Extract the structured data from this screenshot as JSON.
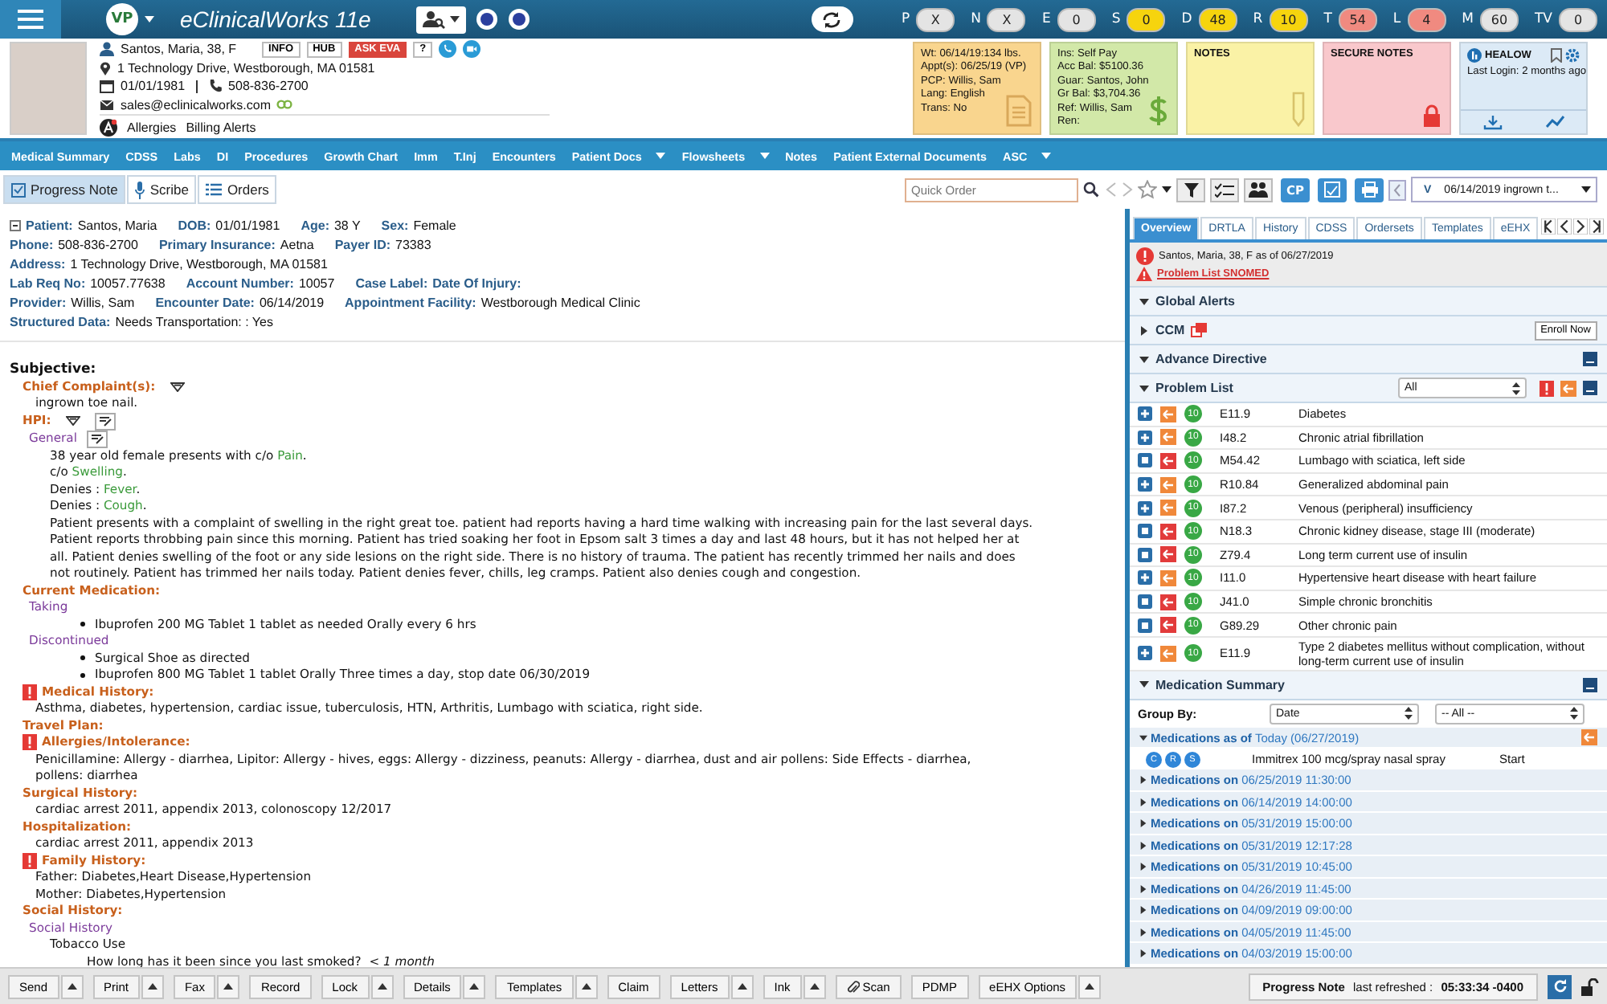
{
  "top_bar": {
    "avatar": "VP",
    "title": "eClinicalWorks 11e",
    "counters": [
      {
        "letter": "P",
        "value": "X",
        "color": "#e4e4e4"
      },
      {
        "letter": "N",
        "value": "X",
        "color": "#e4e4e4"
      },
      {
        "letter": "E",
        "value": "0",
        "color": "#e4e4e4"
      },
      {
        "letter": "S",
        "value": "0",
        "color": "#f6d40e"
      },
      {
        "letter": "D",
        "value": "48",
        "color": "#f6d40e"
      },
      {
        "letter": "R",
        "value": "10",
        "color": "#f6d40e"
      },
      {
        "letter": "T",
        "value": "54",
        "color": "#f08a80"
      },
      {
        "letter": "L",
        "value": "4",
        "color": "#f08a80"
      },
      {
        "letter": "M",
        "value": "60",
        "color": "#e4e4e4"
      },
      {
        "letter": "TV",
        "value": "0",
        "color": "#e4e4e4"
      }
    ]
  },
  "patient": {
    "name": "Santos, Maria, 38, F",
    "buttons": [
      {
        "label": "INFO",
        "kind": "plain"
      },
      {
        "label": "HUB",
        "kind": "plain"
      },
      {
        "label": "ASK EVA",
        "kind": "accent"
      },
      {
        "label": "?",
        "kind": "plain"
      }
    ],
    "address": "1 Technology Drive, Westborough, MA 01581",
    "dob": "01/01/1981",
    "phone": "508-836-2700",
    "email": "sales@eclinicalworks.com",
    "links": [
      "Allergies",
      "Billing Alerts"
    ]
  },
  "cards": [
    {
      "kind": "vitals",
      "color": "#f9d58e",
      "lines": [
        "Wt: 06/14/19:134 lbs.",
        "Appt(s): 06/25/19 (VP)",
        "PCP: Willis, Sam",
        "Lang: English",
        "Trans: No"
      ]
    },
    {
      "kind": "billing",
      "color": "#d2e8a8",
      "lines": [
        "Ins: Self Pay",
        "Acc Bal: $5100.36",
        "Guar: Santos, John",
        "Gr Bal: $3,704.36",
        "Ref: Willis, Sam",
        "Ren:"
      ]
    },
    {
      "kind": "notes",
      "color": "#faf2a6",
      "title": "NOTES"
    },
    {
      "kind": "secure",
      "color": "#f9c8cc",
      "title": "SECURE NOTES"
    },
    {
      "kind": "healow",
      "color": "#dceaf6",
      "title": "HEALOW",
      "lines": [
        "Last Login: 2 months ago"
      ]
    }
  ],
  "nav": [
    {
      "label": "Medical Summary",
      "dropdown": false
    },
    {
      "label": "CDSS",
      "dropdown": false
    },
    {
      "label": "Labs",
      "dropdown": false
    },
    {
      "label": "DI",
      "dropdown": false
    },
    {
      "label": "Procedures",
      "dropdown": false
    },
    {
      "label": "Growth Chart",
      "dropdown": false
    },
    {
      "label": "Imm",
      "dropdown": false
    },
    {
      "label": "T.Inj",
      "dropdown": false
    },
    {
      "label": "Encounters",
      "dropdown": false
    },
    {
      "label": "Patient Docs",
      "dropdown": true
    },
    {
      "label": "Flowsheets",
      "dropdown": true
    },
    {
      "label": "Notes",
      "dropdown": false
    },
    {
      "label": "Patient External Documents",
      "dropdown": false
    },
    {
      "label": "ASC",
      "dropdown": true
    }
  ],
  "toolbar": {
    "tabs": [
      {
        "label": "Progress Note",
        "selected": true
      },
      {
        "label": "Scribe",
        "selected": false
      },
      {
        "label": "Orders",
        "selected": false
      }
    ],
    "quick_order": {
      "placeholder": "Quick Order"
    },
    "cp": "CP",
    "encounter": {
      "prefix": "V",
      "value": "06/14/2019 ingrown t..."
    }
  },
  "header_fields": [
    [
      {
        "label": "Patient:",
        "value": "Santos, Maria"
      },
      {
        "label": "DOB:",
        "value": "01/01/1981"
      },
      {
        "label": "Age:",
        "value": "38 Y"
      },
      {
        "label": "Sex:",
        "value": "Female"
      }
    ],
    [
      {
        "label": "Phone:",
        "value": "508-836-2700"
      },
      {
        "label": "Primary Insurance:",
        "value": "Aetna"
      },
      {
        "label": "Payer ID:",
        "value": "73383"
      }
    ],
    [
      {
        "label": "Address:",
        "value": "1 Technology Drive, Westborough, MA 01581"
      }
    ],
    [
      {
        "label": "Lab Req No:",
        "value": "10057.77638"
      },
      {
        "label": "Account Number:",
        "value": "10057"
      },
      {
        "label": "Case Label:"
      },
      {
        "label": "Date Of Injury:"
      }
    ],
    [
      {
        "label": "Provider:",
        "value": "Willis, Sam"
      },
      {
        "label": "Encounter Date:",
        "value": "06/14/2019"
      },
      {
        "label": "Appointment Facility:",
        "value": "Westborough Medical Clinic"
      }
    ],
    [
      {
        "label": "Structured Data:",
        "value": "Needs Transportation: : Yes"
      }
    ]
  ],
  "note": {
    "heading": "Subjective:",
    "sections": [
      {
        "title": "Chief Complaint(s):",
        "alert": false,
        "menu": true,
        "edit": false,
        "lines": [
          "ingrown toe nail."
        ]
      },
      {
        "title": "HPI:",
        "alert": false,
        "menu": true,
        "edit": true,
        "groups": [
          {
            "title": "General",
            "edit": true,
            "items": [
              {
                "kind": "finding",
                "prefix": "38 year old female presents with c/o ",
                "value": "Pain",
                "suffix": "."
              },
              {
                "kind": "finding",
                "prefix": "c/o ",
                "value": "Swelling",
                "suffix": "."
              },
              {
                "kind": "finding",
                "prefix": "Denies : ",
                "value": "Fever",
                "suffix": "."
              },
              {
                "kind": "finding",
                "prefix": "Denies : ",
                "value": "Cough",
                "suffix": "."
              },
              {
                "kind": "paragraph",
                "text": "Patient presents with a complaint of swelling in the right great toe. patient had reports having a hard time walking with increasing pain for the last several days. Patient reports throbbing pain since this morning. Patient has tried soaking her foot in Epsom salt 3 times a day and last 48 hours, but it has not helped her at all. Patient denies swelling of the foot or any side lesions on the right side. There is no history of trauma. The patient has recently trimmed her nails and does not routinely. Patient has trimmed her nails today. Patient denies fever, chills, leg cramps. Patient also denies cough and congestion."
              }
            ]
          }
        ]
      },
      {
        "title": "Current Medication:",
        "alert": false,
        "groups": [
          {
            "title": "Taking",
            "items": [
              {
                "kind": "bullet",
                "text": "Ibuprofen 200 MG Tablet 1 tablet as needed Orally every 6 hrs"
              }
            ]
          },
          {
            "title": "Discontinued",
            "items": [
              {
                "kind": "bullet",
                "text": "Surgical Shoe as directed"
              },
              {
                "kind": "bullet",
                "text": "Ibuprofen 800 MG Tablet 1 tablet Orally Three times a day, stop date 06/30/2019"
              }
            ]
          }
        ]
      },
      {
        "title": "Medical History:",
        "alert": true,
        "lines": [
          "Asthma, diabetes, hypertension, cardiac issue, tuberculosis, HTN, Arthritis, Lumbago with sciatica, right side."
        ]
      },
      {
        "title": "Travel Plan:",
        "alert": false
      },
      {
        "title": "Allergies/Intolerance:",
        "alert": true,
        "lines": [
          "Penicillamine: Allergy - diarrhea, Lipitor: Allergy - hives, eggs: Allergy - dizziness, peanuts: Allergy - diarrhea, dust and air pollens: Side Effects - diarrhea, pollens: diarrhea"
        ]
      },
      {
        "title": "Surgical History:",
        "alert": false,
        "lines": [
          "cardiac arrest 2011, appendix 2013, colonoscopy 12/2017"
        ]
      },
      {
        "title": "Hospitalization:",
        "alert": false,
        "lines": [
          "cardiac arrest 2011, appendix 2013"
        ]
      },
      {
        "title": "Family History:",
        "alert": true,
        "lines": [
          "Father: Diabetes,Heart Disease,Hypertension",
          "Mother: Diabetes,Hypertension"
        ]
      },
      {
        "title": "Social History:",
        "alert": false,
        "groups": [
          {
            "title": "Social History",
            "items": [
              {
                "kind": "subheading",
                "text": "Tobacco Use"
              },
              {
                "kind": "qa",
                "question": "How long has it been since you last smoked?",
                "answer": "< 1 month"
              }
            ]
          }
        ]
      }
    ]
  },
  "right_panel": {
    "tabs": [
      {
        "label": "Overview",
        "selected": true
      },
      {
        "label": "DRTLA",
        "selected": false
      },
      {
        "label": "History",
        "selected": false
      },
      {
        "label": "CDSS",
        "selected": false
      },
      {
        "label": "Ordersets",
        "selected": false
      },
      {
        "label": "Templates",
        "selected": false
      },
      {
        "label": "eEHX",
        "selected": false
      }
    ],
    "alert": {
      "text": "Santos, Maria, 38, F as of 06/27/2019",
      "link": "Problem List SNOMED"
    },
    "panels": [
      {
        "title": "Global Alerts",
        "expanded": true
      },
      {
        "title": "CCM",
        "expanded": false,
        "button": "Enroll Now"
      },
      {
        "title": "Advance Directive",
        "expanded": true
      }
    ],
    "problem_list": {
      "title": "Problem List",
      "expanded": true,
      "filter": "All",
      "rows": [
        {
          "expandable": true,
          "color": "#f0883a",
          "badge": "10",
          "code": "E11.9",
          "description": "Diabetes"
        },
        {
          "expandable": true,
          "color": "#f0883a",
          "badge": "10",
          "code": "I48.2",
          "description": "Chronic atrial fibrillation"
        },
        {
          "expandable": false,
          "color": "#e23b3b",
          "badge": "10",
          "code": "M54.42",
          "description": "Lumbago with sciatica, left side"
        },
        {
          "expandable": true,
          "color": "#f0883a",
          "badge": "10",
          "code": "R10.84",
          "description": "Generalized abdominal pain"
        },
        {
          "expandable": true,
          "color": "#f0883a",
          "badge": "10",
          "code": "I87.2",
          "description": "Venous (peripheral) insufficiency"
        },
        {
          "expandable": false,
          "color": "#e23b3b",
          "badge": "10",
          "code": "N18.3",
          "description": "Chronic kidney disease, stage III (moderate)"
        },
        {
          "expandable": false,
          "color": "#e23b3b",
          "badge": "10",
          "code": "Z79.4",
          "description": "Long term current use of insulin"
        },
        {
          "expandable": true,
          "color": "#f0883a",
          "badge": "10",
          "code": "I11.0",
          "description": "Hypertensive heart disease with heart failure"
        },
        {
          "expandable": false,
          "color": "#e23b3b",
          "badge": "10",
          "code": "J41.0",
          "description": "Simple chronic bronchitis"
        },
        {
          "expandable": false,
          "color": "#e23b3b",
          "badge": "10",
          "code": "G89.29",
          "description": "Other chronic pain"
        },
        {
          "expandable": true,
          "color": "#f0883a",
          "badge": "10",
          "code": "E11.9",
          "description": "Type 2 diabetes mellitus without complication, without long-term current use of insulin"
        }
      ]
    },
    "medication_summary": {
      "title": "Medication Summary",
      "expanded": true,
      "group_by_label": "Group By:",
      "group_by": "Date",
      "filter": "-- All --",
      "groups": [
        {
          "label": "Medications as of",
          "date": "Today (06/27/2019)",
          "expanded": true,
          "meds": [
            {
              "actions": [
                "C",
                "R",
                "S"
              ],
              "name": "Immitrex 100 mcg/spray nasal spray",
              "status": "Start"
            }
          ]
        },
        {
          "label": "Medications on",
          "date": "06/25/2019 11:30:00",
          "expanded": false
        },
        {
          "label": "Medications on",
          "date": "06/14/2019 14:00:00",
          "expanded": false
        },
        {
          "label": "Medications on",
          "date": "05/31/2019 15:00:00",
          "expanded": false
        },
        {
          "label": "Medications on",
          "date": "05/31/2019 12:17:28",
          "expanded": false
        },
        {
          "label": "Medications on",
          "date": "05/31/2019 10:45:00",
          "expanded": false
        },
        {
          "label": "Medications on",
          "date": "04/26/2019 11:45:00",
          "expanded": false
        },
        {
          "label": "Medications on",
          "date": "04/09/2019 09:00:00",
          "expanded": false
        },
        {
          "label": "Medications on",
          "date": "04/05/2019 11:45:00",
          "expanded": false
        },
        {
          "label": "Medications on",
          "date": "04/03/2019 15:00:00",
          "expanded": false
        }
      ]
    }
  },
  "bottom_bar": {
    "buttons": [
      {
        "label": "Send",
        "menu": true
      },
      {
        "label": "Print",
        "menu": true
      },
      {
        "label": "Fax",
        "menu": true
      },
      {
        "label": "Record",
        "menu": false
      },
      {
        "label": "Lock",
        "menu": true
      },
      {
        "label": "Details",
        "menu": true
      },
      {
        "label": "Templates",
        "menu": true
      },
      {
        "label": "Claim",
        "menu": false
      },
      {
        "label": "Letters",
        "menu": true
      },
      {
        "label": "Ink",
        "menu": true
      },
      {
        "label": "Scan",
        "menu": false,
        "kind": "attach"
      },
      {
        "label": "PDMP",
        "menu": false
      },
      {
        "label": "eEHX Options",
        "menu": true
      }
    ],
    "status": "**Progress Note** last refreshed : **05:33:34 -0400**"
  }
}
